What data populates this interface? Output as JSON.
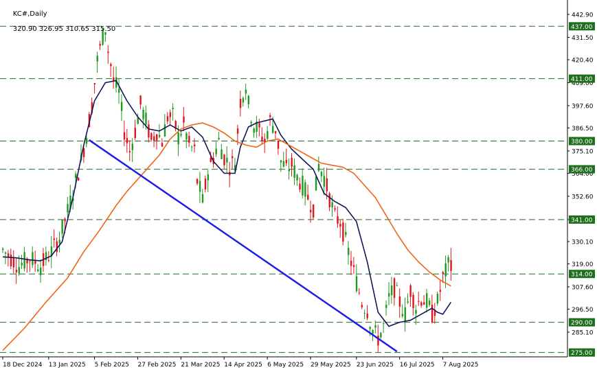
{
  "header": {
    "symbol": "KC#,Daily",
    "ohlc": "320.90 326.95 310.65 315.50"
  },
  "colors": {
    "background": "#ffffff",
    "bull_candle": "#1e9b1e",
    "bear_candle": "#e0141e",
    "ma_fast": "#14145a",
    "ma_slow": "#f06414",
    "trendline": "#1e1ee6",
    "level_line": "#1e6e1e",
    "level_label_bg": "#1e6e1e",
    "level_label_text": "#ffffff",
    "axis": "#000000"
  },
  "chart_data": {
    "type": "candlestick",
    "title": "KC#,Daily",
    "ylim": [
      273.2,
      447.8
    ],
    "y_ticks": [
      "442.90",
      "431.50",
      "420.40",
      "409.00",
      "397.60",
      "386.50",
      "375.10",
      "364.00",
      "352.60",
      "341.00",
      "330.10",
      "319.00",
      "307.60",
      "296.50",
      "285.10"
    ],
    "x_ticks": [
      {
        "label": "18 Dec 2024",
        "index": 0
      },
      {
        "label": "13 Jan 2025",
        "index": 17
      },
      {
        "label": "5 Feb 2025",
        "index": 34
      },
      {
        "label": "27 Feb 2025",
        "index": 50
      },
      {
        "label": "21 Mar 2025",
        "index": 66
      },
      {
        "label": "14 Apr 2025",
        "index": 82
      },
      {
        "label": "6 May 2025",
        "index": 98
      },
      {
        "label": "29 May 2025",
        "index": 114
      },
      {
        "label": "23 Jun 2025",
        "index": 131
      },
      {
        "label": "16 Jul 2025",
        "index": 147
      },
      {
        "label": "7 Aug 2025",
        "index": 163
      }
    ],
    "horizontal_levels": [
      "437.00",
      "411.00",
      "380.00",
      "366.00",
      "341.00",
      "314.00",
      "290.00",
      "275.00"
    ],
    "current_price": "315.50",
    "series": [
      {
        "kind": "line",
        "color_key": "ma_fast",
        "values": [
          [
            0,
            322.5
          ],
          [
            5,
            322
          ],
          [
            10,
            321
          ],
          [
            14,
            320.5
          ],
          [
            18,
            323
          ],
          [
            22,
            330
          ],
          [
            26,
            352
          ],
          [
            30,
            378
          ],
          [
            34,
            400
          ],
          [
            38,
            409
          ],
          [
            42,
            410
          ],
          [
            46,
            400
          ],
          [
            50,
            392
          ],
          [
            54,
            386
          ],
          [
            58,
            385
          ],
          [
            62,
            388
          ],
          [
            66,
            385
          ],
          [
            70,
            387
          ],
          [
            74,
            382
          ],
          [
            78,
            370
          ],
          [
            82,
            364
          ],
          [
            86,
            364
          ],
          [
            88,
            377
          ],
          [
            91,
            387
          ],
          [
            94,
            389
          ],
          [
            97,
            390
          ],
          [
            100,
            391
          ],
          [
            103,
            383
          ],
          [
            107,
            376
          ],
          [
            111,
            371
          ],
          [
            115,
            366
          ],
          [
            119,
            354
          ],
          [
            123,
            350
          ],
          [
            127,
            347
          ],
          [
            131,
            340
          ],
          [
            135,
            320
          ],
          [
            139,
            295
          ],
          [
            143,
            288
          ],
          [
            147,
            290
          ],
          [
            151,
            291
          ],
          [
            155,
            294
          ],
          [
            159,
            297
          ],
          [
            161,
            295
          ],
          [
            163,
            294
          ],
          [
            166,
            300
          ]
        ]
      },
      {
        "kind": "line",
        "color_key": "ma_slow",
        "values": [
          [
            0,
            276
          ],
          [
            8,
            287
          ],
          [
            16,
            300
          ],
          [
            24,
            312
          ],
          [
            30,
            325
          ],
          [
            36,
            336
          ],
          [
            42,
            348
          ],
          [
            46,
            355
          ],
          [
            50,
            361
          ],
          [
            54,
            367
          ],
          [
            58,
            373
          ],
          [
            62,
            381
          ],
          [
            66,
            386
          ],
          [
            70,
            388
          ],
          [
            74,
            389
          ],
          [
            78,
            387
          ],
          [
            82,
            384
          ],
          [
            86,
            380
          ],
          [
            90,
            378
          ],
          [
            94,
            377
          ],
          [
            98,
            380
          ],
          [
            102,
            381
          ],
          [
            106,
            378
          ],
          [
            110,
            375
          ],
          [
            114,
            372
          ],
          [
            118,
            369
          ],
          [
            122,
            368
          ],
          [
            126,
            367
          ],
          [
            130,
            364
          ],
          [
            134,
            358
          ],
          [
            138,
            352
          ],
          [
            142,
            343
          ],
          [
            146,
            334
          ],
          [
            150,
            326
          ],
          [
            154,
            320
          ],
          [
            158,
            315
          ],
          [
            162,
            311
          ],
          [
            166,
            308
          ]
        ]
      },
      {
        "kind": "trendline",
        "color_key": "trendline",
        "from": [
          32,
          380.5
        ],
        "to": [
          146,
          275.5
        ]
      }
    ],
    "candles": []
  }
}
